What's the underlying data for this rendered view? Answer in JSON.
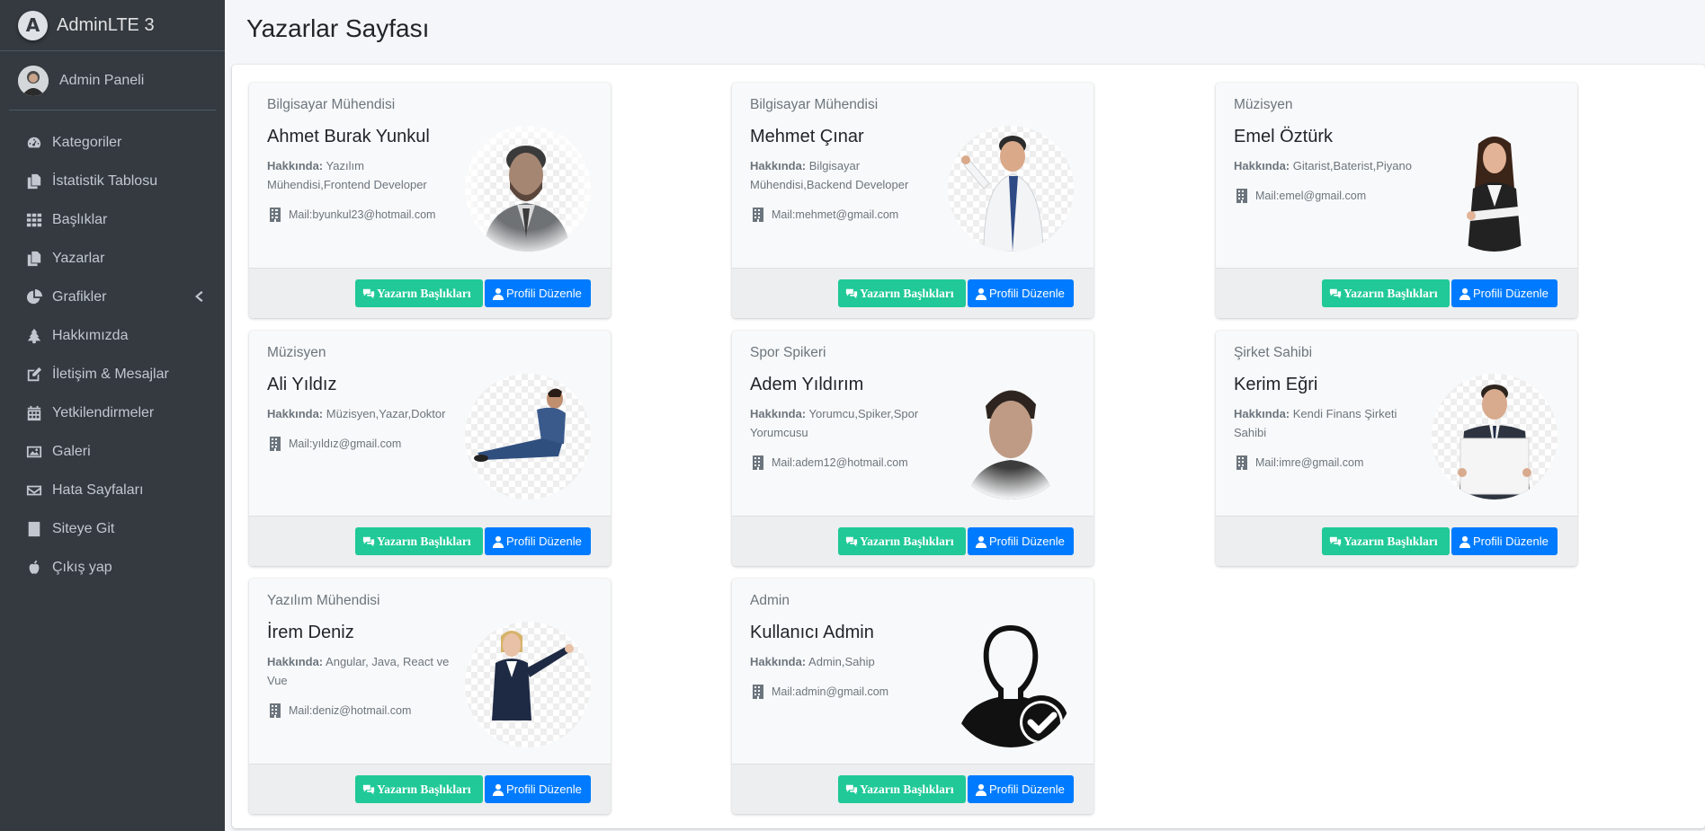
{
  "brand": {
    "name": "AdminLTE 3",
    "logo_letter": "A"
  },
  "user": {
    "name": "Admin Paneli"
  },
  "sidebar": {
    "items": [
      {
        "label": "Kategoriler",
        "icon": "tachometer-icon"
      },
      {
        "label": "İstatistik Tablosu",
        "icon": "copy-icon"
      },
      {
        "label": "Başlıklar",
        "icon": "th-icon"
      },
      {
        "label": "Yazarlar",
        "icon": "copy-icon"
      },
      {
        "label": "Grafikler",
        "icon": "pie-chart-icon",
        "has_arrow": true
      },
      {
        "label": "Hakkımızda",
        "icon": "tree-icon"
      },
      {
        "label": "İletişim & Mesajlar",
        "icon": "edit-icon"
      },
      {
        "label": "Yetkilendirmeler",
        "icon": "calendar-icon"
      },
      {
        "label": "Galeri",
        "icon": "image-icon"
      },
      {
        "label": "Hata Sayfaları",
        "icon": "envelope-icon"
      },
      {
        "label": "Siteye Git",
        "icon": "book-icon"
      },
      {
        "label": "Çıkış yap",
        "icon": "apple-icon"
      }
    ]
  },
  "page": {
    "title": "Yazarlar Sayfası"
  },
  "labels": {
    "about": "Hakkında:",
    "mail_prefix": "Mail: ",
    "btn_titles": "Yazarın Başlıkları",
    "btn_edit": "Profili Düzenle"
  },
  "colors": {
    "sidebar_bg": "#343a40",
    "btn_green": "#20c997",
    "btn_blue": "#007bff"
  },
  "writers": [
    {
      "role": "Bilgisayar Mühendisi",
      "name": "Ahmet Burak Yunkul",
      "about": "Yazılım Mühendisi,Frontend Developer",
      "mail": "byunkul23@hotmail.com"
    },
    {
      "role": "Bilgisayar Mühendisi",
      "name": "Mehmet Çınar",
      "about": "Bilgisayar Mühendisi,Backend Developer",
      "mail": "mehmet@gmail.com"
    },
    {
      "role": "Müzisyen",
      "name": "Emel Öztürk",
      "about": "Gitarist,Baterist,Piyano",
      "mail": "emel@gmail.com"
    },
    {
      "role": "Müzisyen",
      "name": "Ali Yıldız",
      "about": "Müzisyen,Yazar,Doktor",
      "mail": "yıldız@gmail.com"
    },
    {
      "role": "Spor Spikeri",
      "name": "Adem Yıldırım",
      "about": "Yorumcu,Spiker,Spor Yorumcusu",
      "mail": "adem12@hotmail.com"
    },
    {
      "role": "Şirket Sahibi",
      "name": "Kerim Eğri",
      "about": "Kendi Finans Şirketi Sahibi",
      "mail": "imre@gmail.com"
    },
    {
      "role": "Yazılım Mühendisi",
      "name": "İrem Deniz",
      "about": "Angular, Java, React ve Vue",
      "mail": "deniz@hotmail.com"
    },
    {
      "role": "Admin",
      "name": "Kullanıcı Admin",
      "about": "Admin,Sahip",
      "mail": "admin@gmail.com"
    }
  ]
}
